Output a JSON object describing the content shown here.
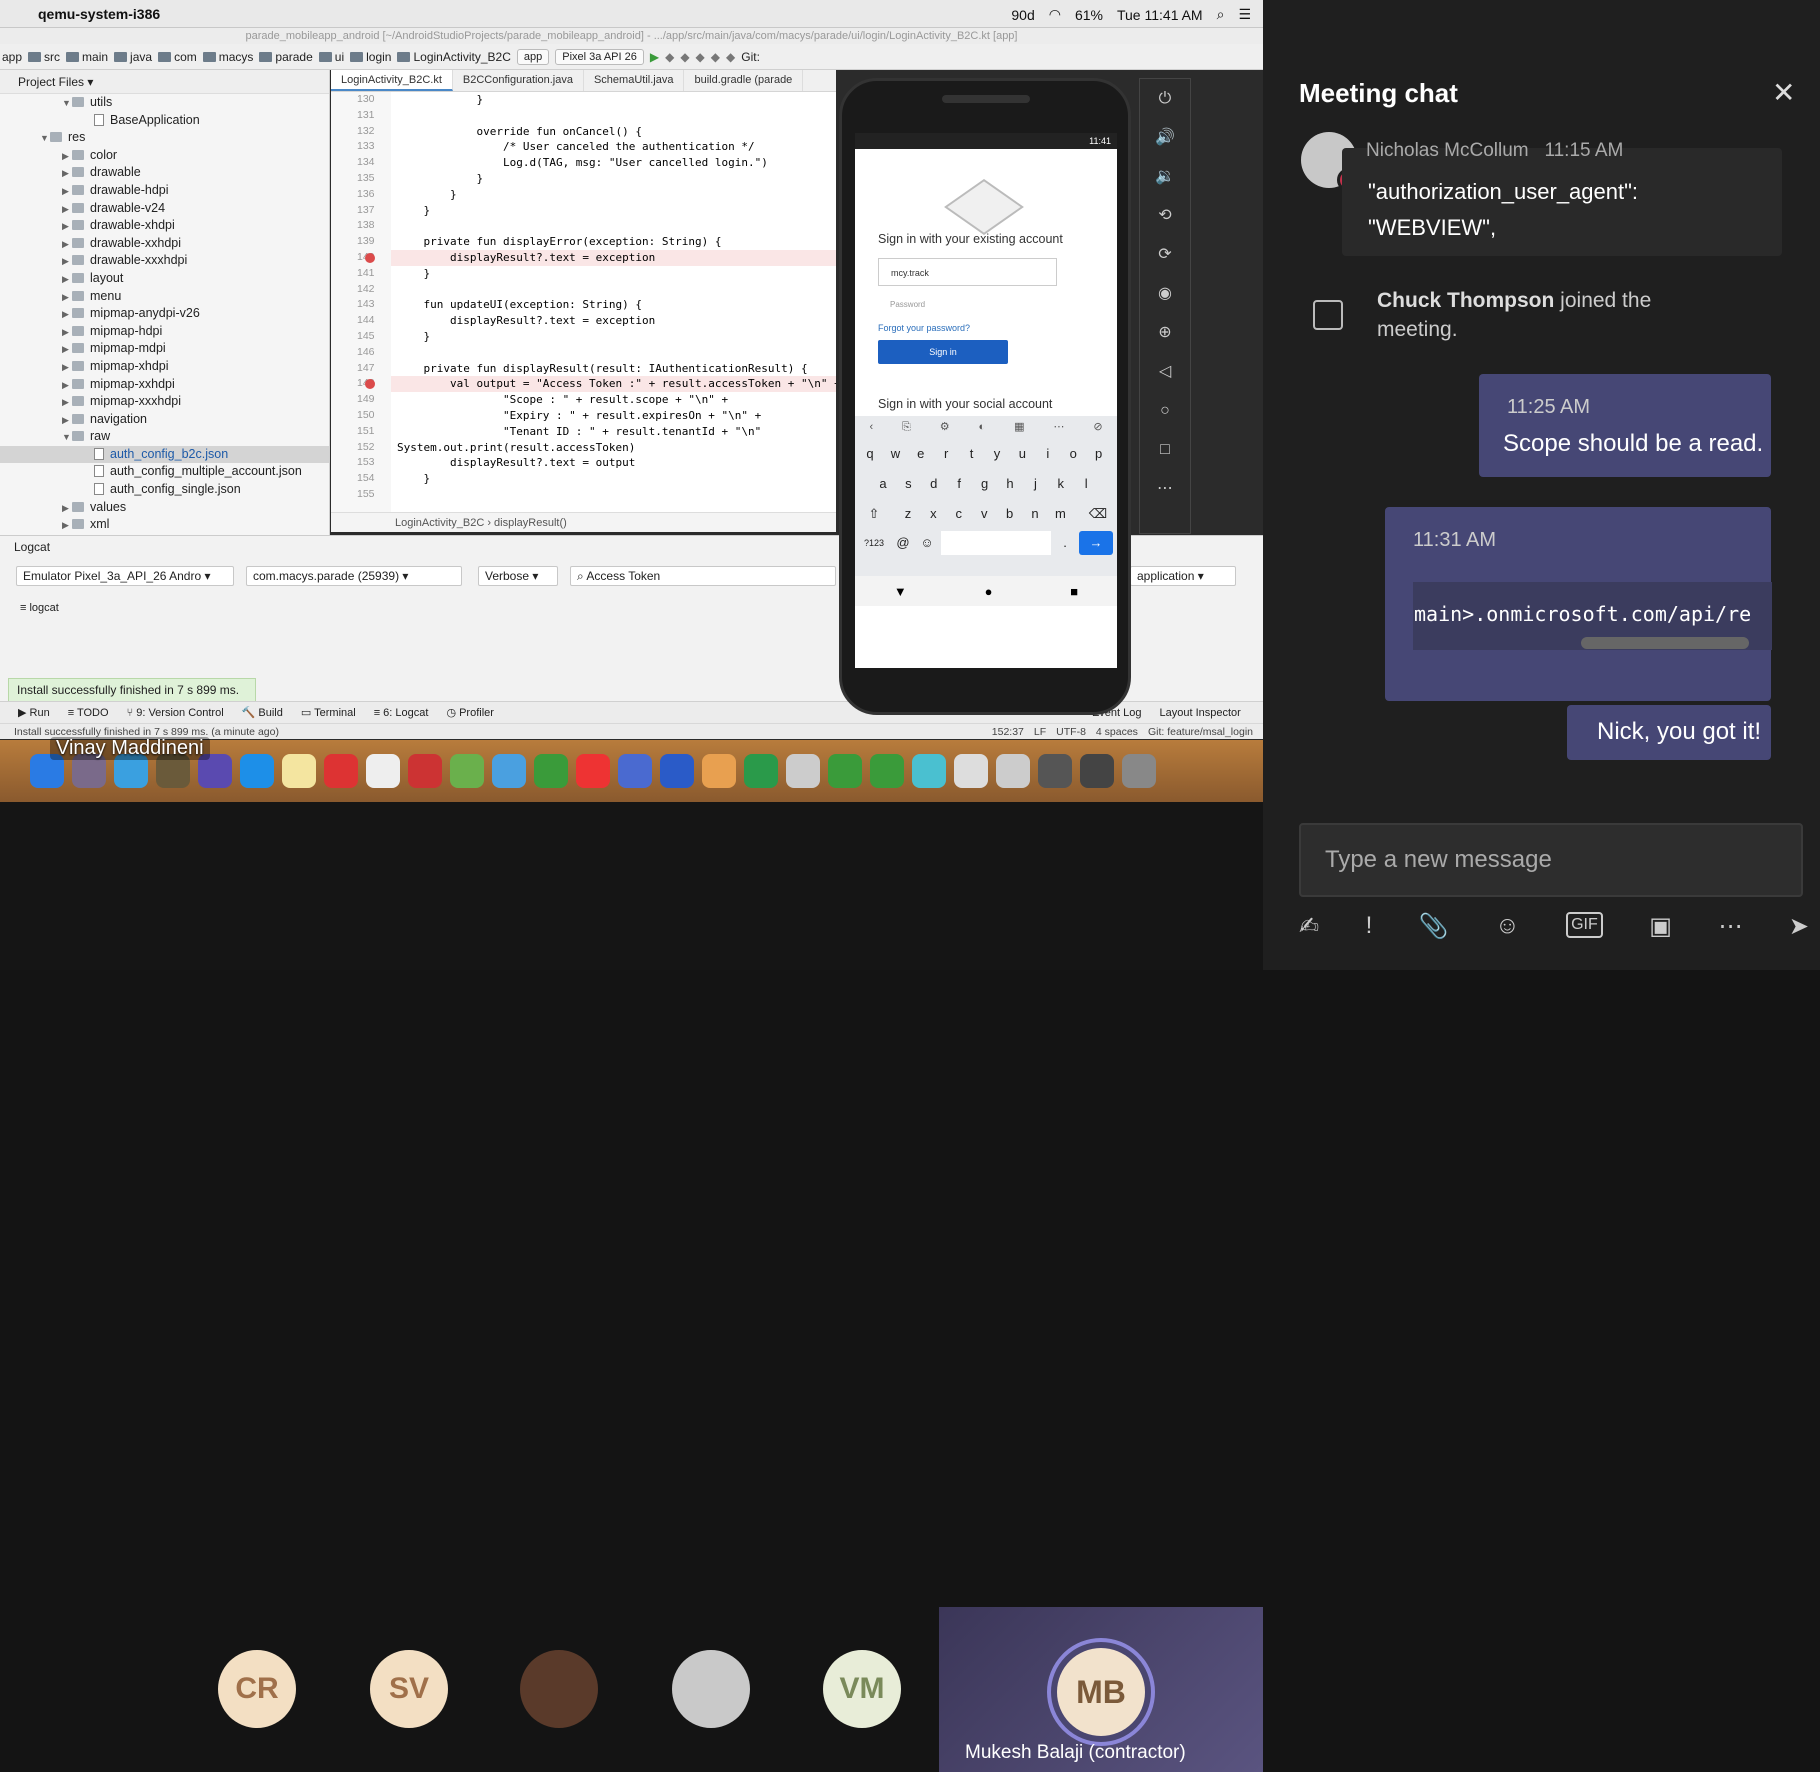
{
  "menubar": {
    "app": "qemu-system-i386",
    "battery": "61%",
    "clock": "Tue 11:41 AM",
    "badge": "90d"
  },
  "window_title": "parade_mobileapp_android [~/AndroidStudioProjects/parade_mobileapp_android] - .../app/src/main/java/com/macys/parade/ui/login/LoginActivity_B2C.kt [app]",
  "navbar": {
    "crumbs": [
      "app",
      "src",
      "main",
      "java",
      "com",
      "macys",
      "parade",
      "ui",
      "login",
      "LoginActivity_B2C"
    ],
    "run_config": "app",
    "device": "Pixel 3a API 26",
    "git": "Git:"
  },
  "project": {
    "header": "Project Files",
    "items": [
      {
        "label": "utils",
        "indent": 2,
        "type": "folder",
        "open": true
      },
      {
        "label": "BaseApplication",
        "indent": 3,
        "type": "class"
      },
      {
        "label": "res",
        "indent": 1,
        "type": "folder",
        "open": true
      },
      {
        "label": "color",
        "indent": 2,
        "type": "folder"
      },
      {
        "label": "drawable",
        "indent": 2,
        "type": "folder"
      },
      {
        "label": "drawable-hdpi",
        "indent": 2,
        "type": "folder"
      },
      {
        "label": "drawable-v24",
        "indent": 2,
        "type": "folder"
      },
      {
        "label": "drawable-xhdpi",
        "indent": 2,
        "type": "folder"
      },
      {
        "label": "drawable-xxhdpi",
        "indent": 2,
        "type": "folder"
      },
      {
        "label": "drawable-xxxhdpi",
        "indent": 2,
        "type": "folder"
      },
      {
        "label": "layout",
        "indent": 2,
        "type": "folder"
      },
      {
        "label": "menu",
        "indent": 2,
        "type": "folder"
      },
      {
        "label": "mipmap-anydpi-v26",
        "indent": 2,
        "type": "folder"
      },
      {
        "label": "mipmap-hdpi",
        "indent": 2,
        "type": "folder"
      },
      {
        "label": "mipmap-mdpi",
        "indent": 2,
        "type": "folder"
      },
      {
        "label": "mipmap-xhdpi",
        "indent": 2,
        "type": "folder"
      },
      {
        "label": "mipmap-xxhdpi",
        "indent": 2,
        "type": "folder"
      },
      {
        "label": "mipmap-xxxhdpi",
        "indent": 2,
        "type": "folder"
      },
      {
        "label": "navigation",
        "indent": 2,
        "type": "folder"
      },
      {
        "label": "raw",
        "indent": 2,
        "type": "folder",
        "open": true
      },
      {
        "label": "auth_config_b2c.json",
        "indent": 3,
        "type": "file",
        "selected": true
      },
      {
        "label": "auth_config_multiple_account.json",
        "indent": 3,
        "type": "file"
      },
      {
        "label": "auth_config_single.json",
        "indent": 3,
        "type": "file"
      },
      {
        "label": "values",
        "indent": 2,
        "type": "folder"
      },
      {
        "label": "xml",
        "indent": 2,
        "type": "folder"
      }
    ]
  },
  "editor": {
    "tabs": [
      "LoginActivity_B2C.kt",
      "B2CConfiguration.java",
      "SchemaUtil.java",
      "build.gradle (parade"
    ],
    "line_numbers": [
      "130",
      "131",
      "132",
      "133",
      "134",
      "135",
      "136",
      "137",
      "138",
      "139",
      "140",
      "141",
      "142",
      "143",
      "144",
      "145",
      "146",
      "147",
      "148",
      "149",
      "150",
      "151",
      "152",
      "153",
      "154",
      "155"
    ],
    "code": [
      "            }",
      "",
      "            override fun onCancel() {",
      "                /* User canceled the authentication */",
      "                Log.d(TAG, msg: \"User cancelled login.\")",
      "            }",
      "        }",
      "    }",
      "",
      "    private fun displayError(exception: String) {",
      "        displayResult?.text = exception",
      "    }",
      "",
      "    fun updateUI(exception: String) {",
      "        displayResult?.text = exception",
      "    }",
      "",
      "    private fun displayResult(result: IAuthenticationResult) {",
      "        val output = \"Access Token :\" + result.accessToken + \"\\n\" +",
      "                \"Scope : \" + result.scope + \"\\n\" +",
      "                \"Expiry : \" + result.expiresOn + \"\\n\" +",
      "                \"Tenant ID : \" + result.tenantId + \"\\n\"",
      "System.out.print(result.accessToken)",
      "        displayResult?.text = output",
      "    }",
      ""
    ],
    "crumbs": "LoginActivity_B2C  ›  displayResult()"
  },
  "phone": {
    "clock": "11:41",
    "heading": "Sign in with your existing account",
    "email": "mcy.track",
    "password_placeholder": "Password",
    "forgot": "Forgot your password?",
    "signin": "Sign in",
    "social": "Sign in with your social account",
    "keys_row1": [
      "q",
      "w",
      "e",
      "r",
      "t",
      "y",
      "u",
      "i",
      "o",
      "p"
    ],
    "keys_row2": [
      "a",
      "s",
      "d",
      "f",
      "g",
      "h",
      "j",
      "k",
      "l"
    ],
    "keys_row3": [
      "z",
      "x",
      "c",
      "v",
      "b",
      "n",
      "m"
    ],
    "sym": "?123",
    "at": "@",
    "dot": "."
  },
  "logcat": {
    "title": "Logcat",
    "device": "Emulator Pixel_3a_API_26 Andro",
    "process": "com.macys.parade (25939)",
    "level": "Verbose",
    "search": "Access Token",
    "filter": "application",
    "tab": "logcat"
  },
  "toast": "Install successfully finished in 7 s 899 ms.",
  "bottom_tabs": [
    "▶ Run",
    "≡ TODO",
    "⑂ 9: Version Control",
    "🔨 Build",
    "▭ Terminal",
    "≡ 6: Logcat",
    "◷ Profiler",
    "Event Log",
    "Layout Inspector"
  ],
  "status": {
    "left": "Install successfully finished in 7 s 899 ms. (a minute ago)",
    "pos": "152:37",
    "lf": "LF",
    "enc": "UTF-8",
    "indent": "4 spaces",
    "git": "Git: feature/msal_login"
  },
  "presenter": "Vinay Maddineni",
  "participants": [
    {
      "initials": "CR"
    },
    {
      "initials": "SV"
    },
    {
      "initials": "VM"
    }
  ],
  "active_speaker": {
    "initials": "MB",
    "name": "Mukesh Balaji (contractor)"
  },
  "chat": {
    "title": "Meeting chat",
    "msg1": {
      "author": "Nicholas McCollum",
      "time": "11:15 AM",
      "text": "\"authorization_user_agent\":\n\"WEBVIEW\","
    },
    "joined_name": "Chuck Thompson",
    "joined_text": " joined the meeting.",
    "msg2": {
      "time": "11:25 AM",
      "text": "Scope should be a read."
    },
    "msg3": {
      "time": "11:31 AM",
      "code": "main>.onmicrosoft.com/api/re"
    },
    "msg4": {
      "text": "Nick, you got it!"
    },
    "composer_placeholder": "Type a new message"
  },
  "colors": {
    "teams_bg": "#1f1f1f",
    "my_bubble": "#464775",
    "accent": "#8b86d8"
  }
}
